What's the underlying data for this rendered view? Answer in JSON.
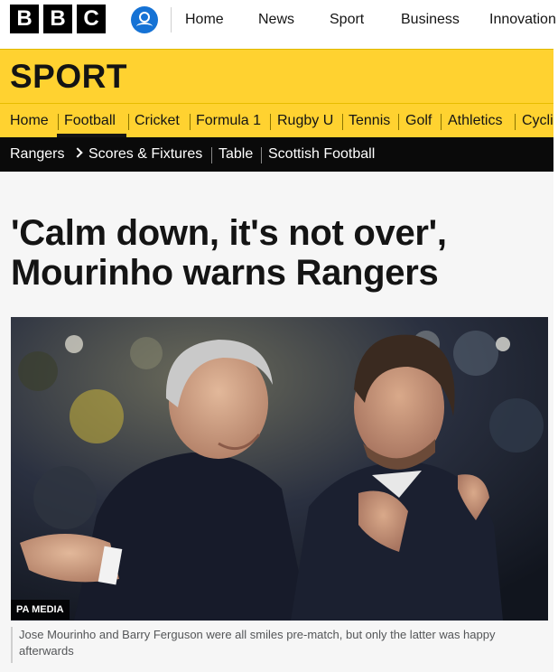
{
  "brand": {
    "letters": [
      "B",
      "B",
      "C"
    ]
  },
  "top_nav": {
    "items": [
      "Home",
      "News",
      "Sport",
      "Business",
      "Innovation"
    ]
  },
  "sport_section": {
    "title": "SPORT"
  },
  "sport_nav": {
    "items": [
      "Home",
      "Football",
      "Cricket",
      "Formula 1",
      "Rugby U",
      "Tennis",
      "Golf",
      "Athletics",
      "Cycli"
    ],
    "active": "Football"
  },
  "sub_nav": {
    "items": [
      "Rangers",
      "Scores & Fixtures",
      "Table",
      "Scottish Football"
    ]
  },
  "article": {
    "headline_line1": "'Calm down, it's not over',",
    "headline_line2": "Mourinho warns Rangers",
    "image_credit": "PA MEDIA",
    "caption": "Jose Mourinho and Barry Ferguson were all smiles pre-match, but only the latter was happy afterwards"
  },
  "colors": {
    "sport_yellow": "#ffd230",
    "account_blue": "#1572d5",
    "subnav_black": "#0a0a0a"
  },
  "icons": [
    "bbc-logo",
    "account-icon",
    "chevron-right-icon"
  ]
}
